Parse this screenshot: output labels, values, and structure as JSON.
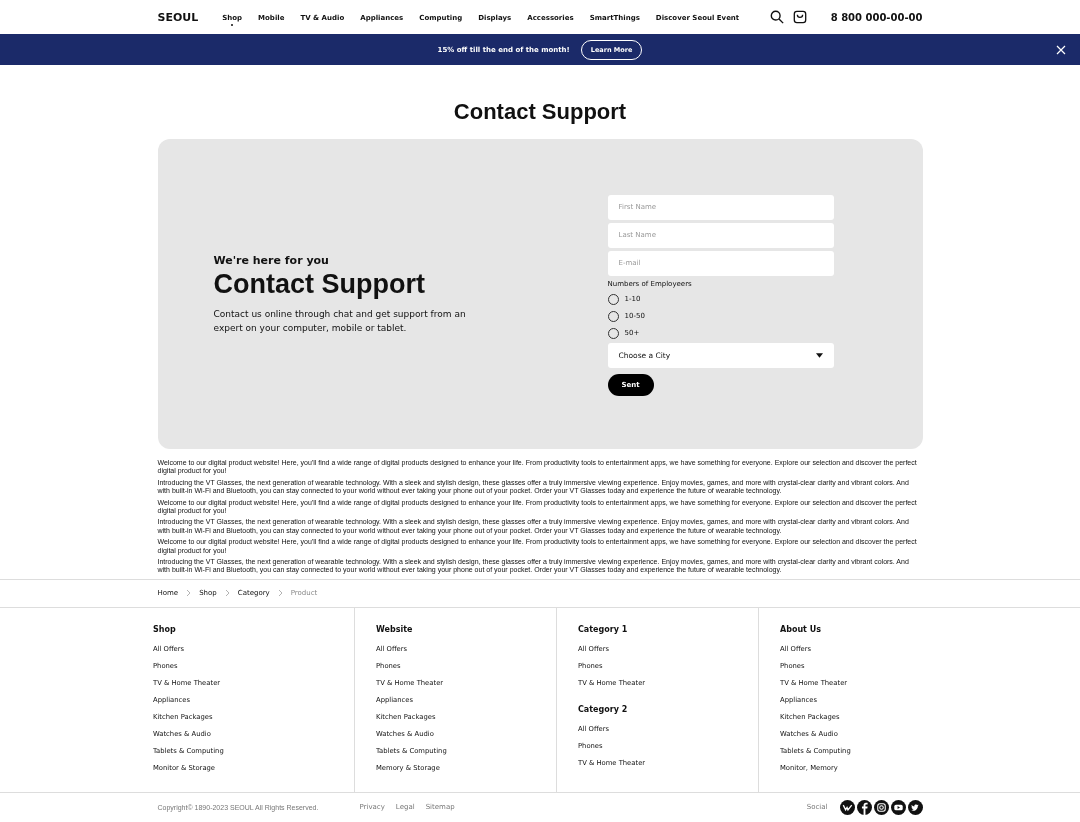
{
  "header": {
    "logo": "SEOUL",
    "nav": [
      {
        "label": "Shop",
        "selected": true
      },
      {
        "label": "Mobile",
        "selected": false
      },
      {
        "label": "TV & Audio",
        "selected": false
      },
      {
        "label": "Appliances",
        "selected": false
      },
      {
        "label": "Computing",
        "selected": false
      },
      {
        "label": "Displays",
        "selected": false
      },
      {
        "label": "Accessories",
        "selected": false
      },
      {
        "label": "SmartThings",
        "selected": false
      },
      {
        "label": "Discover Seoul Event",
        "selected": false
      }
    ],
    "phone": "8 800 000-00-00"
  },
  "banner": {
    "text": "15% off till the end of the month!",
    "button": "Learn More"
  },
  "page_title": "Contact Support",
  "hero": {
    "kicker": "We're here for you",
    "title": "Contact Support",
    "text": "Contact us online through chat and get support from an expert on your computer, mobile or tablet."
  },
  "form": {
    "fields": [
      {
        "placeholder": "First Name"
      },
      {
        "placeholder": "Last Name"
      },
      {
        "placeholder": "E-mail"
      }
    ],
    "radio_label": "Numbers of Employeers",
    "options": [
      {
        "label": "1-10",
        "selected": false
      },
      {
        "label": "10-50",
        "selected": false
      },
      {
        "label": "50+",
        "selected": false
      }
    ],
    "select": "Choose a City",
    "submit": "Sent"
  },
  "paragraphs": [
    "Welcome to our digital product website! Here, you'll find a wide range of digital products designed to enhance your life. From productivity tools to entertainment apps, we have something for everyone. Explore our selection and discover the perfect digital product for you!",
    "Introducing the VT Glasses, the next generation of wearable technology. With a sleek and stylish design, these glasses offer a truly immersive viewing experience. Enjoy movies, games, and more with crystal-clear clarity and vibrant colors. And with built-in Wi-Fi and Bluetooth, you can stay connected to your world without ever taking your phone out of your pocket. Order your VT Glasses today and experience the future of wearable technology.",
    "Welcome to our digital product website! Here, you'll find a wide range of digital products designed to enhance your life. From productivity tools to entertainment apps, we have something for everyone. Explore our selection and discover the perfect digital product for you!",
    "Introducing the VT Glasses, the next generation of wearable technology. With a sleek and stylish design, these glasses offer a truly immersive viewing experience. Enjoy movies, games, and more with crystal-clear clarity and vibrant colors. And with built-in Wi-Fi and Bluetooth, you can stay connected to your world without ever taking your phone out of your pocket. Order your VT Glasses today and experience the future of wearable technology.",
    "Welcome to our digital product website! Here, you'll find a wide range of digital products designed to enhance your life. From productivity tools to entertainment apps, we have something for everyone. Explore our selection and discover the perfect digital product for you!",
    "Introducing the VT Glasses, the next generation of wearable technology. With a sleek and stylish design, these glasses offer a truly immersive viewing experience. Enjoy movies, games, and more with crystal-clear clarity and vibrant colors. And with built-in Wi-Fi and Bluetooth, you can stay connected to your world without ever taking your phone out of your pocket. Order your VT Glasses today and experience the future of wearable technology."
  ],
  "breadcrumb": [
    {
      "label": "Home",
      "current": false
    },
    {
      "label": "Shop",
      "current": false
    },
    {
      "label": "Category",
      "current": false
    },
    {
      "label": "Product",
      "current": true
    }
  ],
  "footer_columns": [
    {
      "groups": [
        {
          "title": "Shop",
          "links": [
            "All Offers",
            "Phones",
            "TV & Home Theater",
            "Appliances",
            "Kitchen Packages",
            "Watches & Audio",
            "Tablets & Computing",
            "Monitor & Storage"
          ]
        }
      ]
    },
    {
      "groups": [
        {
          "title": "Website",
          "links": [
            "All Offers",
            "Phones",
            "TV & Home Theater",
            "Appliances",
            "Kitchen Packages",
            "Watches & Audio",
            "Tablets & Computing",
            "Memory & Storage"
          ]
        }
      ]
    },
    {
      "groups": [
        {
          "title": "Category 1",
          "links": [
            "All Offers",
            "Phones",
            "TV & Home Theater"
          ]
        },
        {
          "title": "Category 2",
          "links": [
            "All Offers",
            "Phones",
            "TV & Home Theater"
          ]
        }
      ]
    },
    {
      "groups": [
        {
          "title": "About Us",
          "links": [
            "All Offers",
            "Phones",
            "TV & Home Theater",
            "Appliances",
            "Kitchen Packages",
            "Watches & Audio",
            "Tablets & Computing",
            "Monitor, Memory"
          ]
        }
      ]
    }
  ],
  "bottom": {
    "copyright": "Copyright© 1890-2023 SEOUL All Rights Reserved.",
    "links": [
      "Privacy",
      "Legal",
      "Sitemap"
    ],
    "social_label": "Social",
    "social": [
      {
        "kind": "vk"
      },
      {
        "kind": "facebook"
      },
      {
        "kind": "instagram"
      },
      {
        "kind": "youtube"
      },
      {
        "kind": "twitter"
      }
    ]
  }
}
